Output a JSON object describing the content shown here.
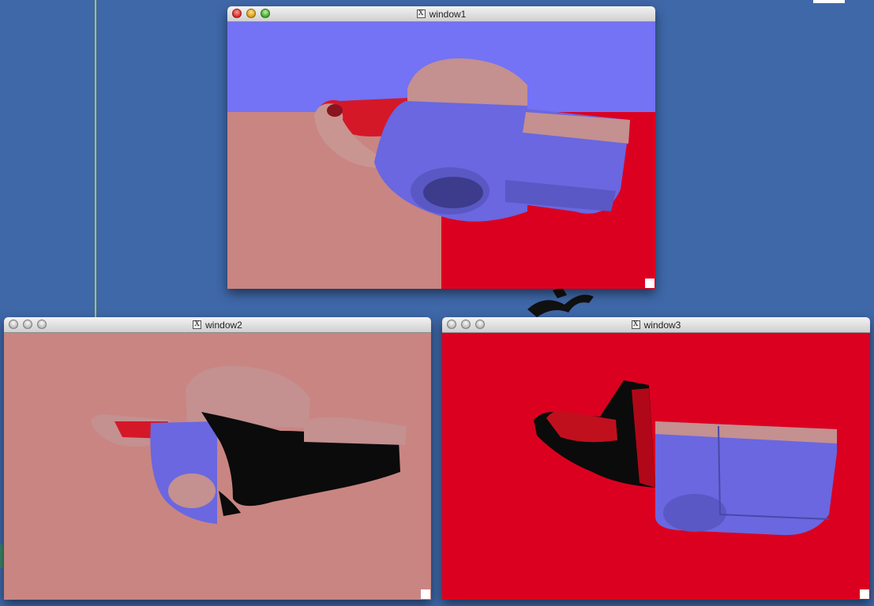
{
  "windows": [
    {
      "title": "window1",
      "icon": "x11-icon",
      "icon_glyph": "X",
      "active": true
    },
    {
      "title": "window2",
      "icon": "x11-icon",
      "icon_glyph": "X",
      "active": false
    },
    {
      "title": "window3",
      "icon": "x11-icon",
      "icon_glyph": "X",
      "active": false
    }
  ],
  "colors": {
    "desktop": "#3f68a9",
    "lavender": "#7472f5",
    "salmon": "#c98582",
    "red": "#dc0020",
    "part_pink": "#c49090",
    "part_blue": "#6a67e0",
    "shadow": "#0b0b0b"
  }
}
